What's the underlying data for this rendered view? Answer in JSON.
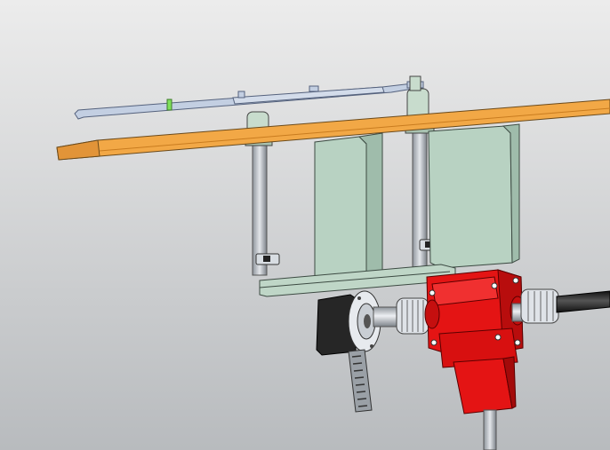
{
  "scene": {
    "background_top": "#ececec",
    "background_bottom": "#b9bcbf",
    "colors": {
      "beam_orange": "#f0a040",
      "beam_orange_dark": "#c97c1f",
      "sheet_blue": "#b9c7dd",
      "sheet_blue_dark": "#7e8fae",
      "bracket_green": "#b8d2c2",
      "bracket_green_dark": "#7f9c8a",
      "gearbox_red": "#e41414",
      "gearbox_red_dark": "#a30a0a",
      "shaft_grey": "#b9bec4",
      "shaft_grey_dark": "#6f757c",
      "motor_black": "#262626",
      "coupling_silver": "#dfe3e8",
      "rack_grey": "#9aa0a6",
      "sensor_green": "#7fe05a"
    },
    "components": [
      "orange-beam",
      "blue-sheet-link",
      "vertical-guide-rod",
      "green-mount-bracket",
      "black-motor-flange",
      "gear-rack",
      "silver-coupling",
      "red-right-angle-gearbox",
      "black-drive-shaft"
    ]
  }
}
